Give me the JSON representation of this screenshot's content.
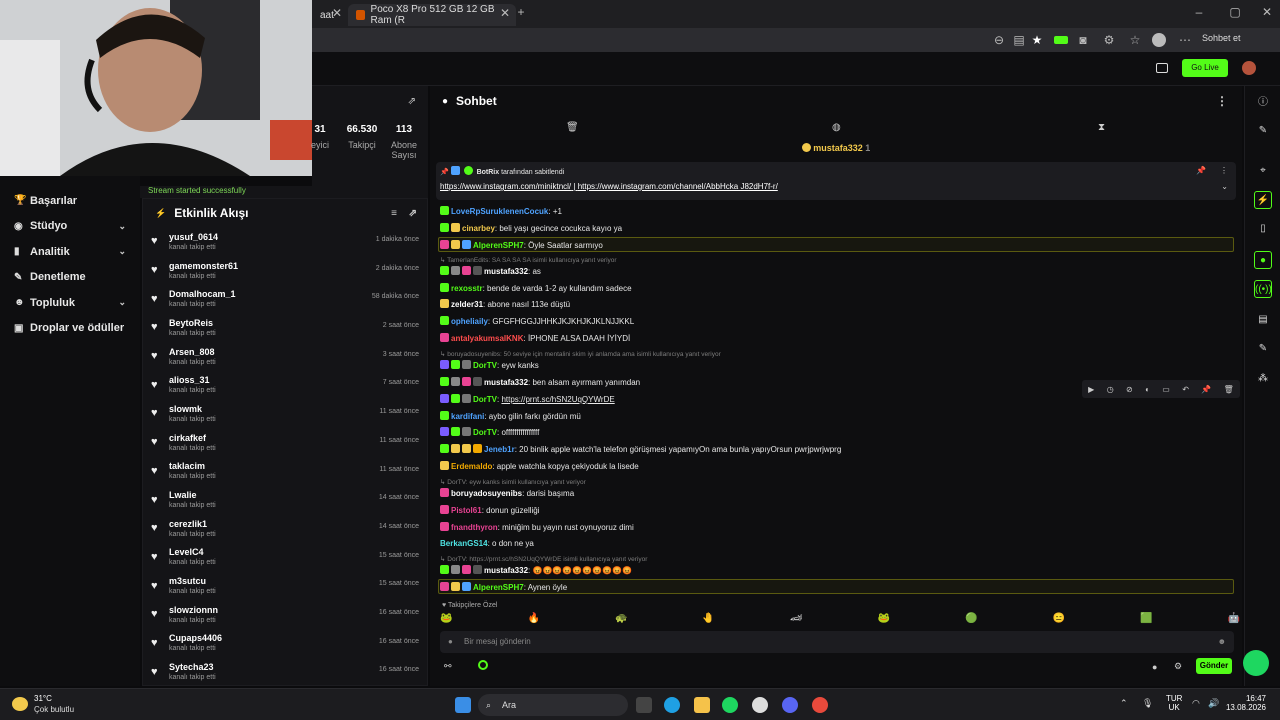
{
  "browser": {
    "tabs": [
      {
        "label": "aat",
        "active": false
      },
      {
        "label": "Poco X8 Pro 512 GB 12 GB Ram (R",
        "active": true
      }
    ],
    "profile_label": "Sohbet et"
  },
  "header": {
    "go_live": "Go Live"
  },
  "sidebar": {
    "items": [
      {
        "label": "Başarılar",
        "chevron": false,
        "icon": "trophy-icon"
      },
      {
        "label": "Stüdyo",
        "chevron": true,
        "icon": "studio-icon"
      },
      {
        "label": "Analitik",
        "chevron": true,
        "icon": "chart-icon"
      },
      {
        "label": "Denetleme",
        "chevron": false,
        "icon": "wrench-icon"
      },
      {
        "label": "Topluluk",
        "chevron": true,
        "icon": "people-icon"
      },
      {
        "label": "Droplar ve ödüller",
        "chevron": false,
        "icon": "gift-icon"
      }
    ]
  },
  "stats": {
    "viewers_value": "31",
    "viewers_label": "eyici",
    "followers_value": "66.530",
    "followers_label": "Takipçi",
    "subs_value": "113",
    "subs_label": "Abone Sayısı"
  },
  "stream_note": "Stream started successfully",
  "feed": {
    "title": "Etkinlik Akışı",
    "item_sub": "kanalı takip etti",
    "items": [
      {
        "user": "yusuf_0614",
        "time": "1 dakika önce"
      },
      {
        "user": "gamemonster61",
        "time": "2 dakika önce"
      },
      {
        "user": "Domalhocam_1",
        "time": "58 dakika önce"
      },
      {
        "user": "BeytoReis",
        "time": "2 saat önce"
      },
      {
        "user": "Arsen_808",
        "time": "3 saat önce"
      },
      {
        "user": "alioss_31",
        "time": "7 saat önce"
      },
      {
        "user": "slowmk",
        "time": "11 saat önce"
      },
      {
        "user": "cirkafkef",
        "time": "11 saat önce"
      },
      {
        "user": "taklacim",
        "time": "11 saat önce"
      },
      {
        "user": "Lwalie",
        "time": "14 saat önce"
      },
      {
        "user": "cerezlik1",
        "time": "14 saat önce"
      },
      {
        "user": "LevelC4",
        "time": "15 saat önce"
      },
      {
        "user": "m3sutcu",
        "time": "15 saat önce"
      },
      {
        "user": "slowzionnn",
        "time": "16 saat önce"
      },
      {
        "user": "Cupaps4406",
        "time": "16 saat önce"
      },
      {
        "user": "Sytecha23",
        "time": "16 saat önce"
      }
    ]
  },
  "chat": {
    "title": "Sohbet",
    "pinned_user": "mustafa332",
    "pinned_count": "1",
    "pin": {
      "by": "BotRix",
      "by_suffix": "tarafından sabitlendi",
      "link1": "https://www.instagram.com/miniktncl/",
      "sep": "|",
      "link2": "https://www.instagram.com/channel/AbbHcka J82dH7f-r/"
    },
    "cut_line": "...",
    "messages": [
      {
        "user": "LoveRpSuruklenenCocuk",
        "color": "#4fa3ff",
        "text": "+1",
        "badges": [
          "#53fc18"
        ]
      },
      {
        "user": "cinarbey",
        "color": "#f2c94c",
        "text": "beli yaşı gecince cocukca kayıo ya",
        "badges": [
          "#53fc18",
          "#f2c94c"
        ]
      },
      {
        "user": "AlperenSPH7",
        "color": "#53fc18",
        "text": "Öyle Saatlar sarmıyo",
        "badges": [
          "#e84393",
          "#f2c94c",
          "#4fa3ff"
        ]
      },
      {
        "reply": "TamerlanEdits: SA SA SA SA isimli kullanıcıya yanıt veriyor"
      },
      {
        "user": "mustafa332",
        "color": "#ffffff",
        "text": "as",
        "badges": [
          "#53fc18",
          "#888",
          "#e84393",
          "#555"
        ]
      },
      {
        "user": "rexosstr",
        "color": "#53fc18",
        "text": "bende de varda 1-2 ay kullandım sadece",
        "badges": [
          "#53fc18"
        ]
      },
      {
        "user": "zelder31",
        "color": "#ffffff",
        "text": "abone nasıl 113e düştü",
        "badges": [
          "#f2c94c"
        ]
      },
      {
        "user": "opheliaily",
        "color": "#4fa3ff",
        "text": "GFGFHGGJJHHKJKJKHJKJKLNJJKKL",
        "badges": [
          "#53fc18"
        ]
      },
      {
        "user": "antalyakumsalKNK",
        "color": "#ff4d4d",
        "text": "İPHONE ALSA DAAH İYİYDİ",
        "badges": [
          "#e84393"
        ]
      },
      {
        "reply": "boruyadosuyenibs: 50 seviye için mentalini skim iyi anlamda ama isimli kullanıcıya yanıt veriyor"
      },
      {
        "user": "DorTV",
        "color": "#53fc18",
        "text": "eyw kanks",
        "badges": [
          "#7a5cff",
          "#53fc18",
          "#777"
        ]
      },
      {
        "user": "mustafa332",
        "color": "#ffffff",
        "text": "ben alsam ayırmam yanımdan",
        "badges": [
          "#53fc18",
          "#888",
          "#e84393",
          "#555"
        ]
      },
      {
        "user": "DorTV",
        "color": "#53fc18",
        "text": "https://prnt.sc/hSN2UqQYWrDE",
        "badges": [
          "#7a5cff",
          "#53fc18",
          "#777"
        ]
      },
      {
        "user": "kardifani",
        "color": "#4fa3ff",
        "text": "aybo gilin farkı gördün mü",
        "badges": [
          "#53fc18"
        ]
      },
      {
        "user": "DorTV",
        "color": "#53fc18",
        "text": "offffffffffffffff",
        "badges": [
          "#7a5cff",
          "#53fc18",
          "#777"
        ]
      },
      {
        "user": "Jeneb1r",
        "color": "#4fa3ff",
        "text": "20 binlik apple watch'la telefon görüşmesi yapamıyOn ama bunla yapıyOrsun pwrjpwrjwprg",
        "badges": [
          "#53fc18",
          "#f2c94c",
          "#f2c94c",
          "#f2a900"
        ]
      },
      {
        "user": "Erdemaldo",
        "color": "#f2a900",
        "text": "apple watchla kopya çekiyoduk la lisede",
        "badges": [
          "#f2c94c"
        ]
      },
      {
        "reply": "DorTV: eyw kanks isimli kullanıcıya yanıt veriyor"
      },
      {
        "user": "boruyadosuyenibs",
        "color": "#ffffff",
        "text": "darisi başıma",
        "badges": [
          "#e84393"
        ]
      },
      {
        "user": "Pistol61",
        "color": "#e84393",
        "text": "donun güzelliği",
        "badges": [
          "#e84393"
        ]
      },
      {
        "user": "fnandthyron",
        "color": "#e84393",
        "text": "miniğim bu yayın rust oynuyoruz dimi",
        "badges": [
          "#e84393"
        ]
      },
      {
        "user": "BerkanGS14",
        "color": "#4fe3e3",
        "text": "o don ne ya",
        "badges": []
      },
      {
        "reply": "DorTV: https://prnt.sc/hSN2UqQYWrDE isimli kullanıcıya yanıt veriyor"
      },
      {
        "user": "mustafa332",
        "color": "#ffffff",
        "text": "😡😡😡😡😡😡😡😡😡😡",
        "badges": [
          "#53fc18",
          "#888",
          "#e84393",
          "#555"
        ]
      },
      {
        "user": "AlperenSPH7",
        "color": "#53fc18",
        "text": "Aynen öyle",
        "badges": [
          "#e84393",
          "#f2c94c",
          "#4fa3ff"
        ]
      }
    ],
    "followers_only": "Takipçilere Özel",
    "input_placeholder": "Bir mesaj gönderin",
    "send_label": "Gönder"
  },
  "taskbar": {
    "weather_temp": "31°C",
    "weather_desc": "Çok bulutlu",
    "search": "Ara",
    "lang": "TUR",
    "lang_sub": "UK",
    "time": "16:47",
    "date": "13.08.2026"
  },
  "colors": {
    "accent": "#53fc18",
    "bg": "#0e0e10",
    "panel": "#141417"
  }
}
